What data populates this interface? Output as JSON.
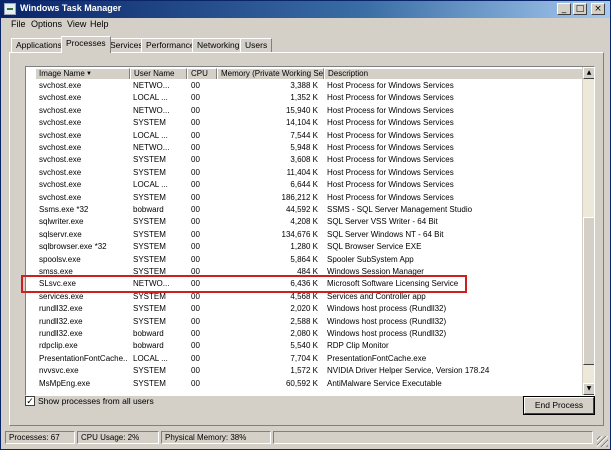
{
  "window": {
    "title": "Windows Task Manager",
    "controls": {
      "minimize": "_",
      "maximize": "□",
      "close": "×"
    }
  },
  "menu": [
    "File",
    "Options",
    "View",
    "Help"
  ],
  "tabs": [
    {
      "label": "Applications"
    },
    {
      "label": "Processes",
      "active": true
    },
    {
      "label": "Services"
    },
    {
      "label": "Performance"
    },
    {
      "label": "Networking"
    },
    {
      "label": "Users"
    }
  ],
  "columns": [
    "Image Name",
    "User Name",
    "CPU",
    "Memory (Private Working Set)",
    "Description"
  ],
  "sort_indicator_icon": "sort-descending-icon",
  "processes": [
    {
      "image": "svchost.exe",
      "user": "NETWO...",
      "cpu": "00",
      "mem": "3,388 K",
      "desc": "Host Process for Windows Services"
    },
    {
      "image": "svchost.exe",
      "user": "LOCAL ...",
      "cpu": "00",
      "mem": "1,352 K",
      "desc": "Host Process for Windows Services"
    },
    {
      "image": "svchost.exe",
      "user": "NETWO...",
      "cpu": "00",
      "mem": "15,940 K",
      "desc": "Host Process for Windows Services"
    },
    {
      "image": "svchost.exe",
      "user": "SYSTEM",
      "cpu": "00",
      "mem": "14,104 K",
      "desc": "Host Process for Windows Services"
    },
    {
      "image": "svchost.exe",
      "user": "LOCAL ...",
      "cpu": "00",
      "mem": "7,544 K",
      "desc": "Host Process for Windows Services"
    },
    {
      "image": "svchost.exe",
      "user": "NETWO...",
      "cpu": "00",
      "mem": "5,948 K",
      "desc": "Host Process for Windows Services"
    },
    {
      "image": "svchost.exe",
      "user": "SYSTEM",
      "cpu": "00",
      "mem": "3,608 K",
      "desc": "Host Process for Windows Services"
    },
    {
      "image": "svchost.exe",
      "user": "SYSTEM",
      "cpu": "00",
      "mem": "11,404 K",
      "desc": "Host Process for Windows Services"
    },
    {
      "image": "svchost.exe",
      "user": "LOCAL ...",
      "cpu": "00",
      "mem": "6,644 K",
      "desc": "Host Process for Windows Services"
    },
    {
      "image": "svchost.exe",
      "user": "SYSTEM",
      "cpu": "00",
      "mem": "186,212 K",
      "desc": "Host Process for Windows Services"
    },
    {
      "image": "Ssms.exe *32",
      "user": "bobward",
      "cpu": "00",
      "mem": "44,592 K",
      "desc": "SSMS - SQL Server Management Studio"
    },
    {
      "image": "sqlwriter.exe",
      "user": "SYSTEM",
      "cpu": "00",
      "mem": "4,208 K",
      "desc": "SQL Server VSS Writer - 64 Bit"
    },
    {
      "image": "sqlservr.exe",
      "user": "SYSTEM",
      "cpu": "00",
      "mem": "134,676 K",
      "desc": "SQL Server Windows NT - 64 Bit",
      "highlighted": true
    },
    {
      "image": "sqlbrowser.exe *32",
      "user": "SYSTEM",
      "cpu": "00",
      "mem": "1,280 K",
      "desc": "SQL Browser Service EXE"
    },
    {
      "image": "spoolsv.exe",
      "user": "SYSTEM",
      "cpu": "00",
      "mem": "5,864 K",
      "desc": "Spooler SubSystem App"
    },
    {
      "image": "smss.exe",
      "user": "SYSTEM",
      "cpu": "00",
      "mem": "484 K",
      "desc": "Windows Session Manager"
    },
    {
      "image": "SLsvc.exe",
      "user": "NETWO...",
      "cpu": "00",
      "mem": "6,436 K",
      "desc": "Microsoft Software Licensing Service"
    },
    {
      "image": "services.exe",
      "user": "SYSTEM",
      "cpu": "00",
      "mem": "4,568 K",
      "desc": "Services and Controller app"
    },
    {
      "image": "rundll32.exe",
      "user": "SYSTEM",
      "cpu": "00",
      "mem": "2,020 K",
      "desc": "Windows host process (Rundll32)"
    },
    {
      "image": "rundll32.exe",
      "user": "SYSTEM",
      "cpu": "00",
      "mem": "2,588 K",
      "desc": "Windows host process (Rundll32)"
    },
    {
      "image": "rundll32.exe",
      "user": "bobward",
      "cpu": "00",
      "mem": "2,080 K",
      "desc": "Windows host process (Rundll32)"
    },
    {
      "image": "rdpclip.exe",
      "user": "bobward",
      "cpu": "00",
      "mem": "5,540 K",
      "desc": "RDP Clip Monitor"
    },
    {
      "image": "PresentationFontCache...",
      "user": "LOCAL ...",
      "cpu": "00",
      "mem": "7,704 K",
      "desc": "PresentationFontCache.exe"
    },
    {
      "image": "nvvsvc.exe",
      "user": "SYSTEM",
      "cpu": "00",
      "mem": "1,572 K",
      "desc": "NVIDIA Driver Helper Service, Version 178.24"
    },
    {
      "image": "MsMpEng.exe",
      "user": "SYSTEM",
      "cpu": "00",
      "mem": "60,592 K",
      "desc": "AntiMalware Service Executable"
    }
  ],
  "show_all": {
    "label": "Show processes from all users",
    "checked": true,
    "check_glyph": "✓"
  },
  "end_process_label": "End Process",
  "status": {
    "processes": "Processes: 67",
    "cpu": "CPU Usage: 2%",
    "memory": "Physical Memory: 38%"
  },
  "scroll_arrows": {
    "up": "▲",
    "down": "▼"
  },
  "colors": {
    "highlight_box": "#cc1f1f",
    "titlebar": "#0a246a",
    "window_bg": "#d4d0c8"
  }
}
